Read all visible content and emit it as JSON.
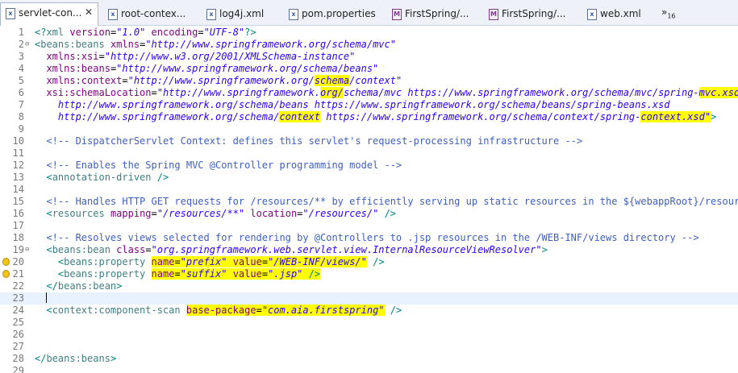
{
  "tabs": [
    {
      "label": "servlet-con...",
      "icon": "xml-file-icon",
      "active": true
    },
    {
      "label": "root-contex...",
      "icon": "xml-file-icon"
    },
    {
      "label": "log4j.xml",
      "icon": "xml-file-icon"
    },
    {
      "label": "pom.properties",
      "icon": "properties-file-icon"
    },
    {
      "label": "FirstSpring/...",
      "icon": "maven-pom-icon"
    },
    {
      "label": "FirstSpring/...",
      "icon": "maven-pom-icon"
    },
    {
      "label": "web.xml",
      "icon": "xml-file-icon"
    }
  ],
  "tab_close_symbol": "✕",
  "overflow": {
    "symbol": "»",
    "count": "16"
  },
  "editor": {
    "current_line": 23,
    "warning_lines": [
      20,
      21
    ],
    "folded_lines": [
      2,
      19
    ],
    "highlight_color": "#ffff00",
    "line_numbers": [
      "1",
      "2",
      "3",
      "4",
      "5",
      "6",
      "7",
      "8",
      "9",
      "10",
      "11",
      "12",
      "13",
      "14",
      "15",
      "16",
      "17",
      "18",
      "19",
      "20",
      "21",
      "22",
      "23",
      "24",
      "25",
      "26",
      "27",
      "28",
      "29"
    ],
    "lines": [
      [
        {
          "k": "p",
          "s": "<?"
        },
        {
          "k": "t",
          "s": "xml"
        },
        {
          "k": "x",
          "s": " "
        },
        {
          "k": "a",
          "s": "version"
        },
        {
          "k": "x",
          "s": "="
        },
        {
          "k": "v",
          "s": "\"1.0\""
        },
        {
          "k": "x",
          "s": " "
        },
        {
          "k": "a",
          "s": "encoding"
        },
        {
          "k": "x",
          "s": "="
        },
        {
          "k": "v",
          "s": "\"UTF-8\""
        },
        {
          "k": "p",
          "s": "?>"
        }
      ],
      [
        {
          "k": "p",
          "s": "<"
        },
        {
          "k": "t",
          "s": "beans:beans"
        },
        {
          "k": "x",
          "s": " "
        },
        {
          "k": "a",
          "s": "xmlns"
        },
        {
          "k": "x",
          "s": "="
        },
        {
          "k": "v",
          "s": "\"http://www.springframework.org/schema/mvc\""
        }
      ],
      [
        {
          "k": "x",
          "s": "  "
        },
        {
          "k": "a",
          "s": "xmlns:xsi"
        },
        {
          "k": "x",
          "s": "="
        },
        {
          "k": "v",
          "s": "\"http://www.w3.org/2001/XMLSchema-instance\""
        }
      ],
      [
        {
          "k": "x",
          "s": "  "
        },
        {
          "k": "a",
          "s": "xmlns:beans"
        },
        {
          "k": "x",
          "s": "="
        },
        {
          "k": "v",
          "s": "\"http://www.springframework.org/schema/beans\""
        }
      ],
      [
        {
          "k": "x",
          "s": "  "
        },
        {
          "k": "a",
          "s": "xmlns:context"
        },
        {
          "k": "x",
          "s": "="
        },
        {
          "k": "v",
          "s": "\"http://www.springframework.org/"
        },
        {
          "k": "v",
          "s": "schema",
          "h": true
        },
        {
          "k": "v",
          "s": "/context\""
        }
      ],
      [
        {
          "k": "x",
          "s": "  "
        },
        {
          "k": "a",
          "s": "xsi:schemaLocation"
        },
        {
          "k": "x",
          "s": "="
        },
        {
          "k": "v",
          "s": "\"http://www.springframework."
        },
        {
          "k": "v",
          "s": "org/",
          "h": true
        },
        {
          "k": "v",
          "s": "schema/mvc https://www.springframework.org/schema/mvc/spring-"
        },
        {
          "k": "v",
          "s": "mvc.xsd",
          "h": true
        }
      ],
      [
        {
          "k": "v",
          "s": "    http://www.springframework.org/schema/beans https://www.springframework.org/schema/beans/spring-beans.xsd"
        }
      ],
      [
        {
          "k": "v",
          "s": "    http://www.springframework.org/schema/"
        },
        {
          "k": "v",
          "s": "context",
          "h": true
        },
        {
          "k": "v",
          "s": " https://www.springframework.org/schema/context/spring-"
        },
        {
          "k": "v",
          "s": "context.xsd\"",
          "h": true
        },
        {
          "k": "p",
          "s": ">"
        }
      ],
      [],
      [
        {
          "k": "x",
          "s": "  "
        },
        {
          "k": "c",
          "s": "<!-- DispatcherServlet Context: defines this servlet's request-processing infrastructure -->"
        }
      ],
      [],
      [
        {
          "k": "x",
          "s": "  "
        },
        {
          "k": "c",
          "s": "<!-- Enables the Spring MVC @Controller programming model -->"
        }
      ],
      [
        {
          "k": "x",
          "s": "  "
        },
        {
          "k": "p",
          "s": "<"
        },
        {
          "k": "t",
          "s": "annotation-driven"
        },
        {
          "k": "x",
          "s": " "
        },
        {
          "k": "p",
          "s": "/>"
        }
      ],
      [],
      [
        {
          "k": "x",
          "s": "  "
        },
        {
          "k": "c",
          "s": "<!-- Handles HTTP GET requests for /resources/** by efficiently serving up static resources in the ${webappRoot}/resources"
        }
      ],
      [
        {
          "k": "x",
          "s": "  "
        },
        {
          "k": "p",
          "s": "<"
        },
        {
          "k": "t",
          "s": "resources"
        },
        {
          "k": "x",
          "s": " "
        },
        {
          "k": "a",
          "s": "mapping"
        },
        {
          "k": "x",
          "s": "="
        },
        {
          "k": "v",
          "s": "\"/resources/**\""
        },
        {
          "k": "x",
          "s": " "
        },
        {
          "k": "a",
          "s": "location"
        },
        {
          "k": "x",
          "s": "="
        },
        {
          "k": "v",
          "s": "\"/resources/\""
        },
        {
          "k": "x",
          "s": " "
        },
        {
          "k": "p",
          "s": "/>"
        }
      ],
      [],
      [
        {
          "k": "x",
          "s": "  "
        },
        {
          "k": "c",
          "s": "<!-- Resolves views selected for rendering by @Controllers to .jsp resources in the /WEB-INF/views directory -->"
        }
      ],
      [
        {
          "k": "x",
          "s": "  "
        },
        {
          "k": "p",
          "s": "<"
        },
        {
          "k": "t",
          "s": "beans:bean"
        },
        {
          "k": "x",
          "s": " "
        },
        {
          "k": "a",
          "s": "class"
        },
        {
          "k": "x",
          "s": "="
        },
        {
          "k": "v",
          "s": "\"org.springframework.web.servlet.view.InternalResourceViewResolver\""
        },
        {
          "k": "p",
          "s": ">"
        }
      ],
      [
        {
          "k": "x",
          "s": "    "
        },
        {
          "k": "p",
          "s": "<"
        },
        {
          "k": "t",
          "s": "beans:property"
        },
        {
          "k": "x",
          "s": " "
        },
        {
          "k": "a",
          "s": "name",
          "h": true
        },
        {
          "k": "x",
          "s": "=",
          "h": true
        },
        {
          "k": "v",
          "s": "\"prefix\"",
          "h": true
        },
        {
          "k": "x",
          "s": " ",
          "h": true
        },
        {
          "k": "a",
          "s": "value",
          "h": true
        },
        {
          "k": "x",
          "s": "=",
          "h": true
        },
        {
          "k": "v",
          "s": "\"/WEB-INF/views/\"",
          "h": true
        },
        {
          "k": "x",
          "s": " "
        },
        {
          "k": "p",
          "s": "/>"
        }
      ],
      [
        {
          "k": "x",
          "s": "    "
        },
        {
          "k": "p",
          "s": "<"
        },
        {
          "k": "t",
          "s": "beans:property"
        },
        {
          "k": "x",
          "s": " "
        },
        {
          "k": "a",
          "s": "name",
          "h": true
        },
        {
          "k": "x",
          "s": "=",
          "h": true
        },
        {
          "k": "v",
          "s": "\"suffix\"",
          "h": true
        },
        {
          "k": "x",
          "s": " ",
          "h": true
        },
        {
          "k": "a",
          "s": "value",
          "h": true
        },
        {
          "k": "x",
          "s": "=",
          "h": true
        },
        {
          "k": "v",
          "s": "\".jsp\"",
          "h": true
        },
        {
          "k": "x",
          "s": " ",
          "h": true
        },
        {
          "k": "p",
          "s": "/>",
          "h": true
        }
      ],
      [
        {
          "k": "x",
          "s": "  "
        },
        {
          "k": "p",
          "s": "</"
        },
        {
          "k": "t",
          "s": "beans:bean"
        },
        {
          "k": "p",
          "s": ">"
        }
      ],
      [
        {
          "k": "x",
          "s": "  "
        }
      ],
      [
        {
          "k": "x",
          "s": "  "
        },
        {
          "k": "p",
          "s": "<"
        },
        {
          "k": "t",
          "s": "context:component-scan"
        },
        {
          "k": "x",
          "s": " "
        },
        {
          "k": "a",
          "s": "base-package",
          "h": true
        },
        {
          "k": "x",
          "s": "=",
          "h": true
        },
        {
          "k": "v",
          "s": "\"com.aia.firstspring\"",
          "h": true
        },
        {
          "k": "x",
          "s": " "
        },
        {
          "k": "p",
          "s": "/>"
        }
      ],
      [],
      [],
      [],
      [
        {
          "k": "p",
          "s": "</"
        },
        {
          "k": "t",
          "s": "beans:beans"
        },
        {
          "k": "p",
          "s": ">"
        }
      ],
      []
    ]
  }
}
